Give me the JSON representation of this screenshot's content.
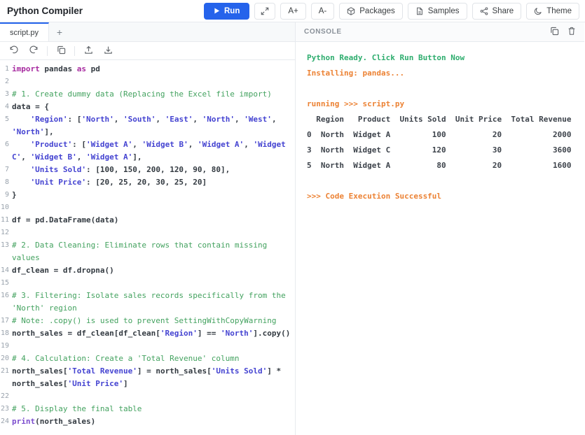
{
  "header": {
    "title": "Python Compiler",
    "actions": {
      "run": "Run",
      "font_increase": "A+",
      "font_decrease": "A-",
      "packages": "Packages",
      "samples": "Samples",
      "share": "Share",
      "theme": "Theme"
    }
  },
  "editor": {
    "tab": "script.py",
    "new_tab": "+",
    "lines": [
      {
        "n": "1",
        "t": [
          [
            "kw",
            "import"
          ],
          [
            "pl",
            " pandas "
          ],
          [
            "kw",
            "as"
          ],
          [
            "pl",
            " pd"
          ]
        ]
      },
      {
        "n": "2",
        "t": []
      },
      {
        "n": "3",
        "t": [
          [
            "com",
            "# 1. Create dummy data (Replacing the Excel file import)"
          ]
        ]
      },
      {
        "n": "4",
        "t": [
          [
            "pl",
            "data = {"
          ]
        ]
      },
      {
        "n": "5",
        "t": [
          [
            "pl",
            "    "
          ],
          [
            "str",
            "'Region'"
          ],
          [
            "pl",
            ": ["
          ],
          [
            "str",
            "'North'"
          ],
          [
            "pl",
            ", "
          ],
          [
            "str",
            "'South'"
          ],
          [
            "pl",
            ", "
          ],
          [
            "str",
            "'East'"
          ],
          [
            "pl",
            ", "
          ],
          [
            "str",
            "'North'"
          ],
          [
            "pl",
            ", "
          ],
          [
            "str",
            "'West'"
          ],
          [
            "pl",
            ", "
          ],
          [
            "str",
            "'North'"
          ],
          [
            "pl",
            "],"
          ]
        ]
      },
      {
        "n": "6",
        "t": [
          [
            "pl",
            "    "
          ],
          [
            "str",
            "'Product'"
          ],
          [
            "pl",
            ": ["
          ],
          [
            "str",
            "'Widget A'"
          ],
          [
            "pl",
            ", "
          ],
          [
            "str",
            "'Widget B'"
          ],
          [
            "pl",
            ", "
          ],
          [
            "str",
            "'Widget A'"
          ],
          [
            "pl",
            ", "
          ],
          [
            "str",
            "'Widget C'"
          ],
          [
            "pl",
            ", "
          ],
          [
            "str",
            "'Widget B'"
          ],
          [
            "pl",
            ", "
          ],
          [
            "str",
            "'Widget A'"
          ],
          [
            "pl",
            "],"
          ]
        ]
      },
      {
        "n": "7",
        "t": [
          [
            "pl",
            "    "
          ],
          [
            "str",
            "'Units Sold'"
          ],
          [
            "pl",
            ": [100, 150, 200, 120, 90, 80],"
          ]
        ]
      },
      {
        "n": "8",
        "t": [
          [
            "pl",
            "    "
          ],
          [
            "str",
            "'Unit Price'"
          ],
          [
            "pl",
            ": [20, 25, 20, 30, 25, 20]"
          ]
        ]
      },
      {
        "n": "9",
        "t": [
          [
            "pl",
            "}"
          ]
        ]
      },
      {
        "n": "10",
        "t": []
      },
      {
        "n": "11",
        "t": [
          [
            "pl",
            "df = pd.DataFrame(data)"
          ]
        ]
      },
      {
        "n": "12",
        "t": []
      },
      {
        "n": "13",
        "t": [
          [
            "com",
            "# 2. Data Cleaning: Eliminate rows that contain missing values"
          ]
        ]
      },
      {
        "n": "14",
        "t": [
          [
            "pl",
            "df_clean = df.dropna()"
          ]
        ]
      },
      {
        "n": "15",
        "t": []
      },
      {
        "n": "16",
        "t": [
          [
            "com",
            "# 3. Filtering: Isolate sales records specifically from the 'North' region"
          ]
        ]
      },
      {
        "n": "17",
        "t": [
          [
            "com",
            "# Note: .copy() is used to prevent SettingWithCopyWarning"
          ]
        ]
      },
      {
        "n": "18",
        "t": [
          [
            "pl",
            "north_sales = df_clean[df_clean["
          ],
          [
            "str",
            "'Region'"
          ],
          [
            "pl",
            "] == "
          ],
          [
            "str",
            "'North'"
          ],
          [
            "pl",
            "].copy()"
          ]
        ]
      },
      {
        "n": "19",
        "t": []
      },
      {
        "n": "20",
        "t": [
          [
            "com",
            "# 4. Calculation: Create a 'Total Revenue' column"
          ]
        ]
      },
      {
        "n": "21",
        "t": [
          [
            "pl",
            "north_sales["
          ],
          [
            "str",
            "'Total Revenue'"
          ],
          [
            "pl",
            "] = north_sales["
          ],
          [
            "str",
            "'Units Sold'"
          ],
          [
            "pl",
            "] * north_sales["
          ],
          [
            "str",
            "'Unit Price'"
          ],
          [
            "pl",
            "]"
          ]
        ]
      },
      {
        "n": "22",
        "t": []
      },
      {
        "n": "23",
        "t": [
          [
            "com",
            "# 5. Display the final table"
          ]
        ]
      },
      {
        "n": "24",
        "t": [
          [
            "fn",
            "print"
          ],
          [
            "pl",
            "(north_sales)"
          ]
        ]
      }
    ]
  },
  "console": {
    "title": "CONSOLE",
    "lines": [
      {
        "type": "success",
        "text": "Python Ready. Click Run Button Now"
      },
      {
        "type": "warn",
        "text": "Installing: pandas..."
      },
      {
        "type": "blank",
        "text": ""
      },
      {
        "type": "warn",
        "text": "running >>> script.py"
      },
      {
        "type": "out",
        "text": "  Region   Product  Units Sold  Unit Price  Total Revenue"
      },
      {
        "type": "out",
        "text": "0  North  Widget A         100          20           2000"
      },
      {
        "type": "out",
        "text": "3  North  Widget C         120          30           3600"
      },
      {
        "type": "out",
        "text": "5  North  Widget A          80          20           1600"
      },
      {
        "type": "blank",
        "text": ""
      },
      {
        "type": "warn",
        "text": ">>> Code Execution Successful"
      }
    ]
  },
  "colors": {
    "accent": "#2563eb",
    "keyword": "#a72ba0",
    "string": "#4443d1",
    "comment": "#43a25f",
    "func": "#7c4dce",
    "success": "#2ead6e",
    "warn": "#ec8234",
    "out": "#3d434b"
  }
}
